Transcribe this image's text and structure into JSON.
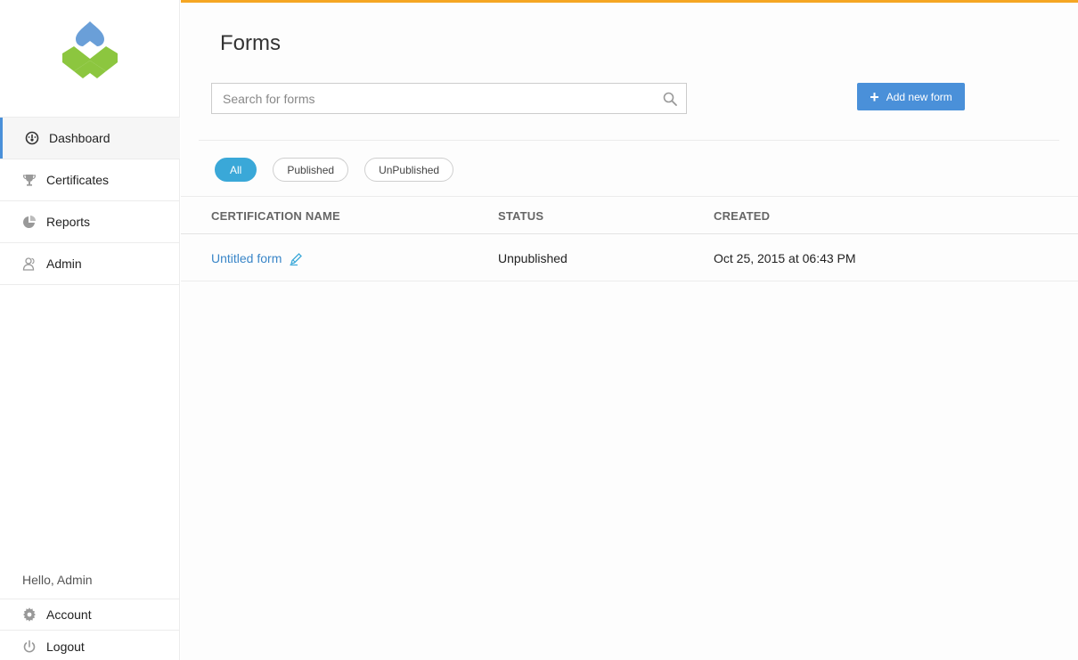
{
  "brand": {
    "colors": {
      "accent": "#f5a623",
      "primary": "#4a90d9",
      "pill_active": "#3aa8d8",
      "logo_blue": "#6a9fd8",
      "logo_green": "#8cc63f"
    }
  },
  "sidebar": {
    "items": [
      {
        "label": "Dashboard",
        "icon": "dashboard-gauge-icon",
        "active": true
      },
      {
        "label": "Certificates",
        "icon": "trophy-icon",
        "active": false
      },
      {
        "label": "Reports",
        "icon": "pie-chart-icon",
        "active": false
      },
      {
        "label": "Admin",
        "icon": "users-icon",
        "active": false
      }
    ],
    "greeting": "Hello, Admin",
    "bottom": [
      {
        "label": "Account",
        "icon": "gear-icon"
      },
      {
        "label": "Logout",
        "icon": "power-icon"
      }
    ]
  },
  "main": {
    "title": "Forms",
    "search": {
      "placeholder": "Search for forms",
      "value": ""
    },
    "add_button": "Add new form",
    "filters": [
      "All",
      "Published",
      "UnPublished"
    ],
    "active_filter": "All",
    "table": {
      "columns": [
        "CERTIFICATION NAME",
        "STATUS",
        "CREATED"
      ],
      "rows": [
        {
          "name": "Untitled form",
          "status": "Unpublished",
          "created": "Oct 25, 2015 at 06:43 PM"
        }
      ]
    }
  }
}
